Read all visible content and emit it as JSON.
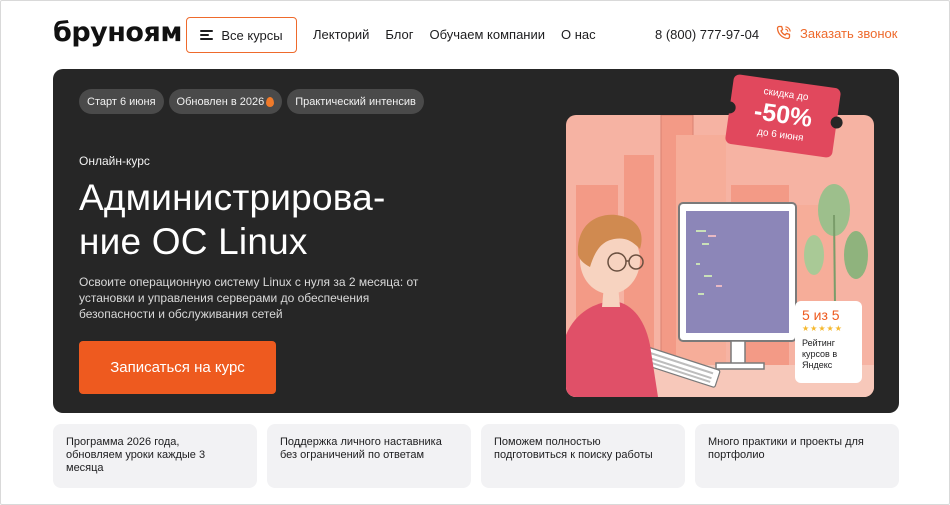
{
  "header": {
    "logo": "бруноям",
    "all_courses_label": "Все курсы",
    "nav": [
      "Лекторий",
      "Блог",
      "Обучаем компании",
      "О нас"
    ],
    "phone": "8 (800) 777-97-04",
    "callback_label": "Заказать звонок"
  },
  "hero": {
    "tags": [
      "Старт 6 июня",
      "Обновлен в 2026",
      "Практический интенсив"
    ],
    "kicker": "Онлайн-курс",
    "title_lines": [
      "Администрирова-",
      "ние ОС Linux"
    ],
    "description_lines": [
      "Освоите операционную систему Linux с нуля за 2 месяца: от",
      "установки и управления серверами до обеспечения",
      "безопасности и обслуживания сетей"
    ],
    "cta_label": "Записаться на курс",
    "discount": {
      "line1": "скидка до",
      "value": "-50%",
      "line3": "до 6 июня"
    },
    "rating": {
      "score": "5 из 5",
      "stars": 5,
      "label_lines": [
        "Рейтинг",
        "курсов в",
        "Яндекс"
      ]
    }
  },
  "features": [
    [
      "Программа 2026 года,",
      "обновляем уроки каждые 3",
      "месяца"
    ],
    [
      "Поддержка личного наставника",
      "без ограничений по ответам"
    ],
    [
      "Поможем полностью",
      "подготовиться к поиску работы"
    ],
    [
      "Много практики и проекты для",
      "портфолио"
    ]
  ],
  "colors": {
    "accent": "#ee5a1f",
    "hero_bg": "#262626",
    "discount": "#e1485d",
    "feature_bg": "#f2f2f4"
  },
  "icons": [
    "menu-icon",
    "phone-icon",
    "fire-icon",
    "star-icon"
  ]
}
